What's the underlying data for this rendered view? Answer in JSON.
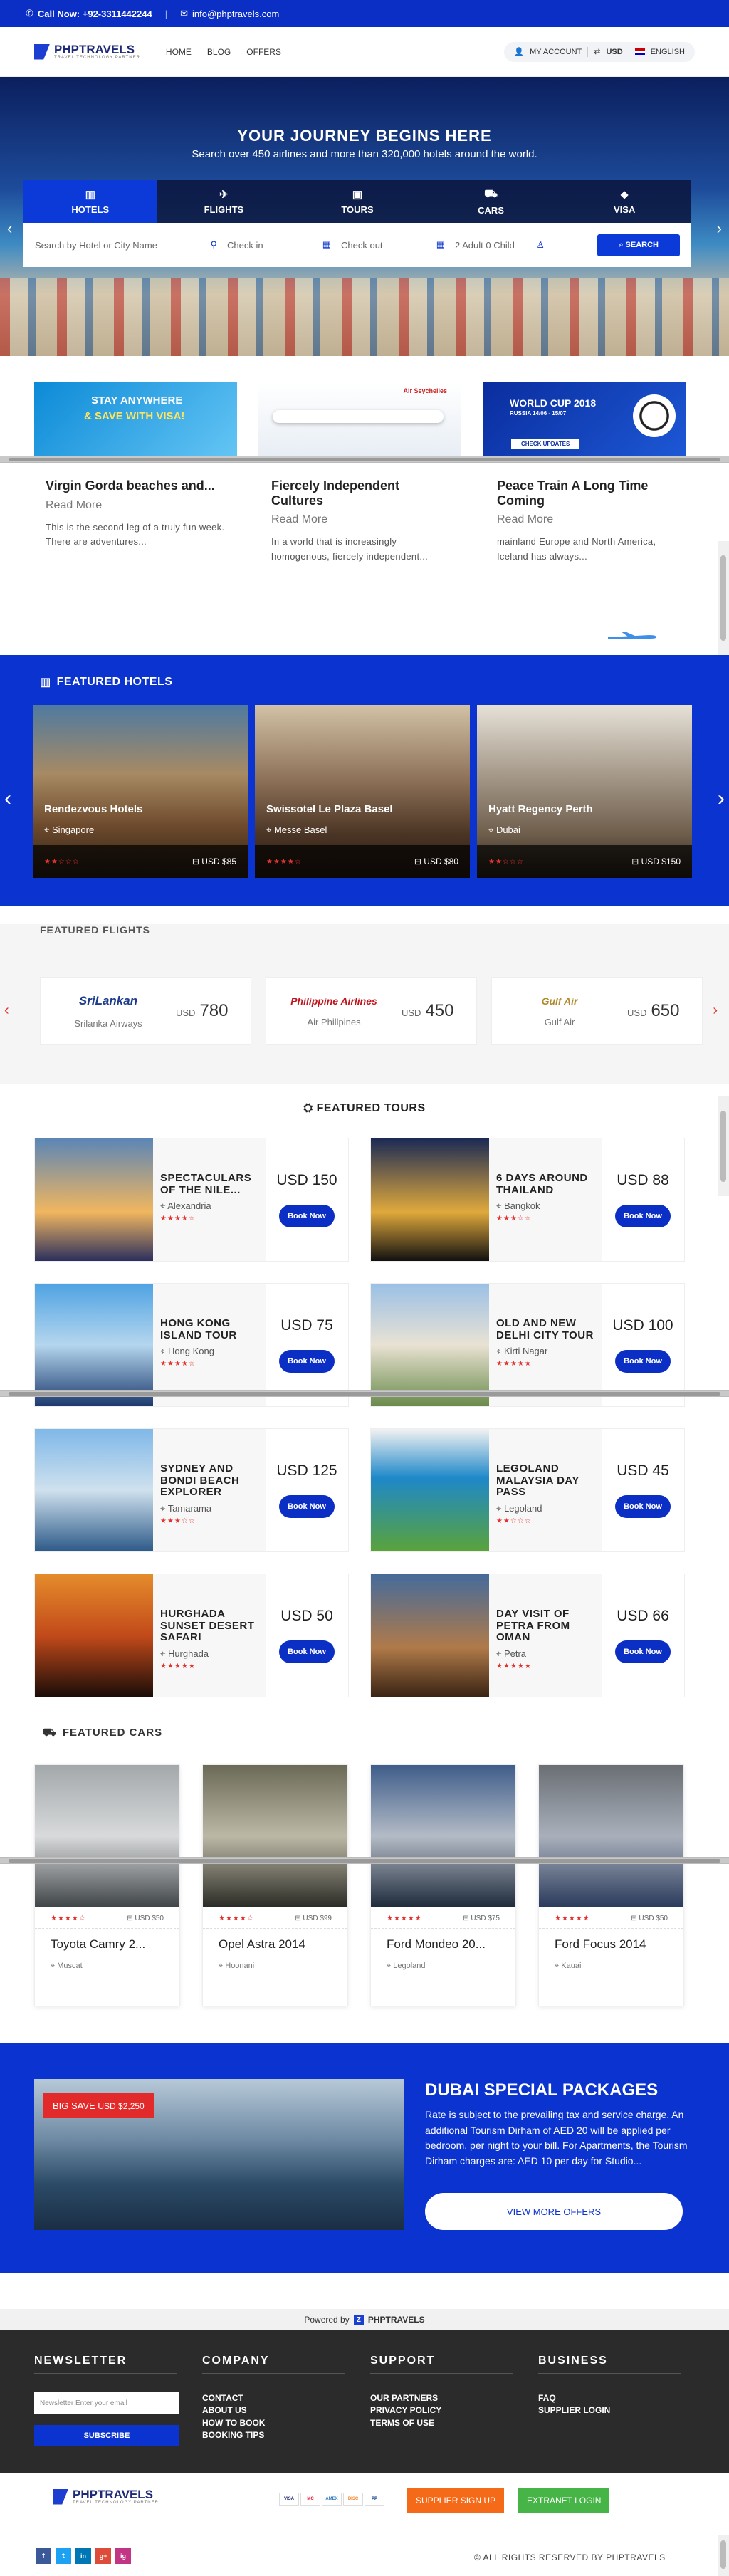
{
  "topbar": {
    "call": "Call Now: +92-3311442244",
    "email": "info@phptravels.com"
  },
  "brand": {
    "name": "PHPTRAVELS",
    "tagline": "TRAVEL TECHNOLOGY PARTNER"
  },
  "nav": {
    "links": [
      "HOME",
      "BLOG",
      "OFFERS"
    ],
    "account": "MY ACCOUNT",
    "currency": "USD",
    "language": "ENGLISH"
  },
  "hero": {
    "title": "YOUR JOURNEY BEGINS HERE",
    "subtitle": "Search over 450 airlines and more than 320,000 hotels around the world.",
    "tabs": [
      "HOTELS",
      "FLIGHTS",
      "TOURS",
      "CARS",
      "VISA"
    ],
    "search_placeholder": "Search by Hotel or City Name",
    "checkin": "Check in",
    "checkout": "Check out",
    "guests": "2 Adult 0 Child",
    "search_button": "SEARCH"
  },
  "banners": {
    "b1": {
      "line1": "STAY ANYWHERE",
      "line2": "& SAVE WITH VISA!"
    },
    "b2": {
      "brand": "Air Seychelles"
    },
    "b3": {
      "title": "WORLD CUP 2018",
      "sub": "RUSSIA 14/06 - 15/07",
      "cta": "CHECK UPDATES"
    }
  },
  "blogs": [
    {
      "title": "Virgin Gorda beaches and...",
      "more": "Read More",
      "excerpt": "This is the second leg of a truly fun week. There are adventures..."
    },
    {
      "title": "Fiercely Independent Cultures",
      "more": "Read More",
      "excerpt": "In a world that is increasingly homogenous, fiercely independent..."
    },
    {
      "title": "Peace Train A Long Time Coming",
      "more": "Read More",
      "excerpt": "mainland Europe and North America, Iceland has always..."
    }
  ],
  "featured_hotels": {
    "title": "FEATURED HOTELS",
    "items": [
      {
        "name": "Rendezvous Hotels",
        "location": "Singapore",
        "price": "USD $85",
        "rating": "★★☆☆☆"
      },
      {
        "name": "Swissotel Le Plaza Basel",
        "location": "Messe Basel",
        "price": "USD $80",
        "rating": "★★★★☆"
      },
      {
        "name": "Hyatt Regency Perth",
        "location": "Dubai",
        "price": "USD $150",
        "rating": "★★☆☆☆"
      }
    ]
  },
  "featured_flights": {
    "title": "FEATURED FLIGHTS",
    "items": [
      {
        "logo": "SriLankan",
        "airline": "Srilanka Airways",
        "currency": "USD",
        "price": "780"
      },
      {
        "logo": "Philippine Airlines",
        "airline": "Air Phillpines",
        "currency": "USD",
        "price": "450"
      },
      {
        "logo": "Gulf Air",
        "airline": "Gulf Air",
        "currency": "USD",
        "price": "650"
      }
    ]
  },
  "featured_tours": {
    "title": "FEATURED TOURS",
    "book": "Book Now",
    "items": [
      {
        "name": "SPECTACULARS OF THE NILE...",
        "location": "Alexandria",
        "price": "USD 150",
        "rating": "★★★★☆"
      },
      {
        "name": "6 DAYS AROUND THAILAND",
        "location": "Bangkok",
        "price": "USD 88",
        "rating": "★★★☆☆"
      },
      {
        "name": "HONG KONG ISLAND TOUR",
        "location": "Hong Kong",
        "price": "USD 75",
        "rating": "★★★★☆"
      },
      {
        "name": "OLD AND NEW DELHI CITY TOUR",
        "location": "Kirti Nagar",
        "price": "USD 100",
        "rating": "★★★★★"
      },
      {
        "name": "SYDNEY AND BONDI BEACH EXPLORER",
        "location": "Tamarama",
        "price": "USD 125",
        "rating": "★★★☆☆"
      },
      {
        "name": "LEGOLAND MALAYSIA DAY PASS",
        "location": "Legoland",
        "price": "USD 45",
        "rating": "★★☆☆☆"
      },
      {
        "name": "HURGHADA SUNSET DESERT SAFARI",
        "location": "Hurghada",
        "price": "USD 50",
        "rating": "★★★★★"
      },
      {
        "name": "DAY VISIT OF PETRA FROM OMAN",
        "location": "Petra",
        "price": "USD 66",
        "rating": "★★★★★"
      }
    ]
  },
  "featured_cars": {
    "title": "FEATURED CARS",
    "items": [
      {
        "name": "Toyota Camry 2...",
        "location": "Muscat",
        "price": "USD $50",
        "rating": "★★★★☆"
      },
      {
        "name": "Opel Astra 2014",
        "location": "Hoonani",
        "price": "USD $99",
        "rating": "★★★★☆"
      },
      {
        "name": "Ford Mondeo 20...",
        "location": "Legoland",
        "price": "USD $75",
        "rating": "★★★★★"
      },
      {
        "name": "Ford Focus 2014",
        "location": "Kauai",
        "price": "USD $50",
        "rating": "★★★★★"
      }
    ]
  },
  "dubai": {
    "badge": "BIG SAVE",
    "badge_price": "USD $2,250",
    "title": "DUBAI SPECIAL PACKAGES",
    "text": "Rate is subject to the prevailing tax and service charge. An additional Tourism Dirham of AED 20 will be applied per bedroom, per night to your bill. For Apartments, the Tourism Dirham charges are: AED 10 per day for Studio...",
    "cta": "VIEW MORE OFFERS"
  },
  "powered": {
    "label": "Powered by",
    "brand": "PHPTRAVELS"
  },
  "footer": {
    "newsletter": {
      "title": "NEWSLETTER",
      "placeholder": "Newsletter Enter your email",
      "button": "SUBSCRIBE"
    },
    "company": {
      "title": "COMPANY",
      "links": [
        "CONTACT",
        "ABOUT US",
        "HOW TO BOOK",
        "BOOKING TIPS"
      ]
    },
    "support": {
      "title": "SUPPORT",
      "links": [
        "OUR PARTNERS",
        "PRIVACY POLICY",
        "TERMS OF USE"
      ]
    },
    "business": {
      "title": "BUSINESS",
      "links": [
        "FAQ",
        "SUPPLIER LOGIN"
      ]
    }
  },
  "bottom": {
    "payments": [
      "VISA",
      "MC",
      "AMEX",
      "DISC",
      "PP"
    ],
    "supplier": "SUPPLIER SIGN UP",
    "extranet": "EXTRANET LOGIN",
    "socials": [
      "f",
      "t",
      "in",
      "g+",
      "ig"
    ],
    "copyright": "© ALL RIGHTS RESERVED BY PHPTRAVELS"
  },
  "colors": {
    "primary": "#0b33d0",
    "accent": "#e3342f",
    "orange": "#f46a19",
    "green": "#47b448",
    "footer": "#2b2b2b"
  }
}
